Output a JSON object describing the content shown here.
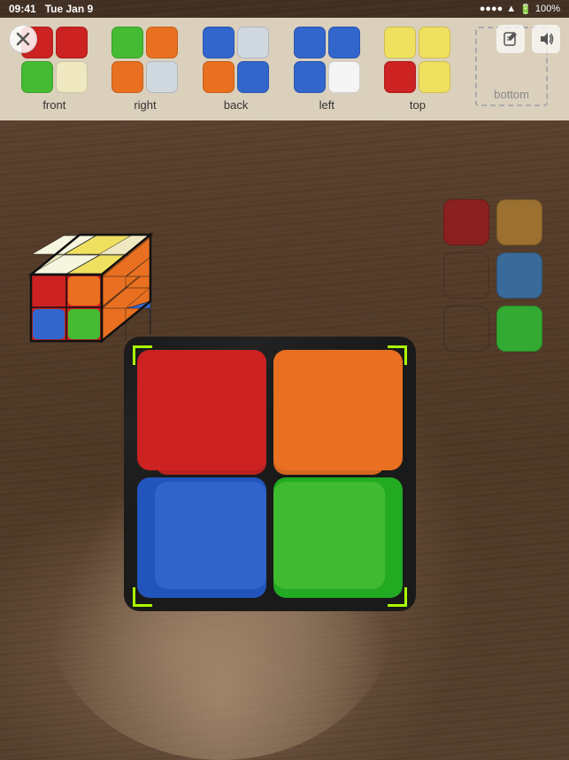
{
  "statusBar": {
    "time": "09:41",
    "date": "Tue Jan 9",
    "battery": "100%",
    "signal": "●●●●",
    "wifi": "wifi"
  },
  "header": {
    "closeLabel": "×",
    "editIcon": "✎",
    "soundIcon": "🔊"
  },
  "faces": [
    {
      "name": "front",
      "label": "front",
      "colors": [
        "#cc2222",
        "#cc2222",
        "#44bb33",
        "#f5f5e0"
      ]
    },
    {
      "name": "right",
      "label": "right",
      "colors": [
        "#44bb33",
        "#e87020",
        "#e87020",
        "#d0d8e0"
      ]
    },
    {
      "name": "back",
      "label": "back",
      "colors": [
        "#3366cc",
        "#d0d8e0",
        "#e87020",
        "#3366cc"
      ]
    },
    {
      "name": "left",
      "label": "left",
      "colors": [
        "#3366cc",
        "#3366cc",
        "#3366cc",
        "#f5f5f5"
      ]
    },
    {
      "name": "top",
      "label": "top",
      "colors": [
        "#f0e060",
        "#f0e060",
        "#cc2222",
        "#f0e060"
      ]
    },
    {
      "name": "bottom",
      "label": "bottom",
      "isPlaceholder": true,
      "colors": []
    }
  ],
  "floatingSwatches": [
    {
      "color": "#8b2020",
      "visible": true
    },
    {
      "color": "#9b7030",
      "visible": true
    },
    {
      "color": "transparent",
      "visible": false
    },
    {
      "color": "#3a6a99",
      "visible": true
    },
    {
      "color": "transparent",
      "visible": false
    },
    {
      "color": "#33aa33",
      "visible": true
    }
  ],
  "cubeDiagram": {
    "frontFace": [
      "#cc2222",
      "#e87020",
      "#3366cc",
      "#44bb33"
    ],
    "topFace": [
      "#f5f5e0",
      "#f0e060",
      "#f5f5e0",
      "#f5f5e0"
    ],
    "rightFace": [
      "#e87020",
      "#e87020",
      "#e87020",
      "#3366cc"
    ]
  },
  "scanningFace": {
    "colors": [
      "#cc2222",
      "#e87020",
      "#3366cc",
      "#44bb33"
    ]
  },
  "labels": {
    "front": "front",
    "right": "right",
    "back": "back",
    "left": "left",
    "top": "top",
    "bottom": "bottom"
  }
}
